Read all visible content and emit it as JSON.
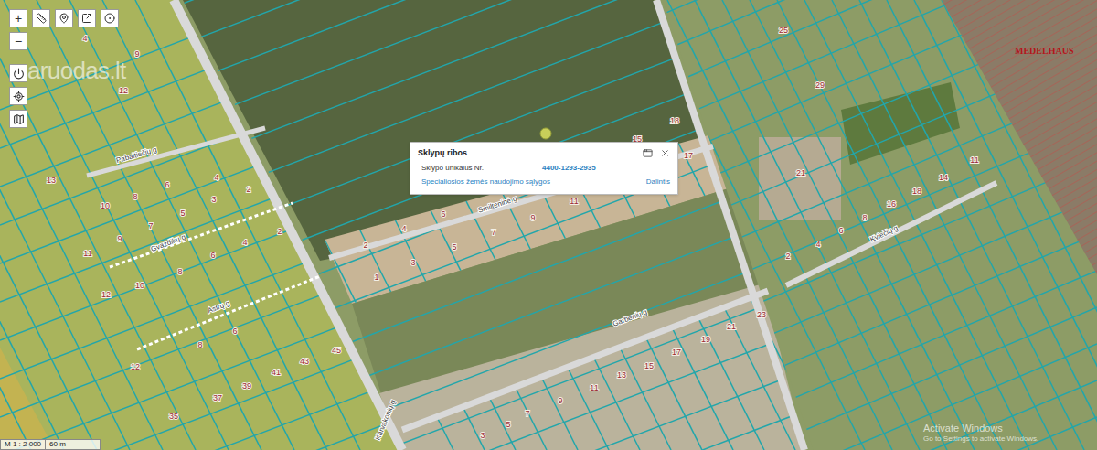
{
  "toolbar": {
    "zoom_in": "+",
    "zoom_out": "−"
  },
  "watermark": "aruodas.lt",
  "logo": "MEDELHAUS",
  "popup": {
    "title": "Sklypų ribos",
    "label": "Sklypo unikalus Nr.",
    "value": "4400-1293-2935",
    "link": "Specialiosios žemės naudojimo sąlygos",
    "share": "Dalintis"
  },
  "streets": [
    "Pabaltiečių g",
    "Gvazdikų g",
    "Astrų g",
    "Smilteninė g",
    "Garbenių g",
    "Kviečių g",
    "Karvakonių g"
  ],
  "parcels": [
    "4",
    "9",
    "12",
    "13",
    "10",
    "8",
    "6",
    "4",
    "2",
    "11",
    "9",
    "7",
    "5",
    "3",
    "12",
    "10",
    "8",
    "6",
    "4",
    "2",
    "12",
    "8",
    "6",
    "41",
    "43",
    "45",
    "39",
    "37",
    "35",
    "1",
    "2",
    "3",
    "4",
    "5",
    "6",
    "7",
    "9",
    "11",
    "15",
    "18",
    "17",
    "25",
    "29",
    "21",
    "2",
    "4",
    "6",
    "8",
    "16",
    "18",
    "14",
    "11",
    "23",
    "21",
    "19",
    "17",
    "15",
    "13",
    "11",
    "9",
    "7",
    "5",
    "3"
  ],
  "scale": {
    "ratio": "M 1 : 2 000",
    "distance": "60 m"
  },
  "os_notice": {
    "title": "Activate Windows",
    "subtitle": "Go to Settings to activate Windows."
  }
}
